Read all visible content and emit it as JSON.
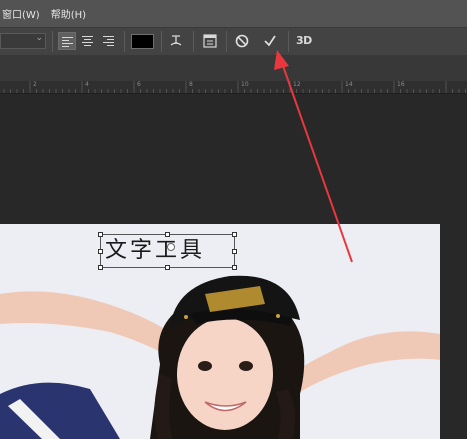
{
  "menu": {
    "items": [
      {
        "label": "窗口(W)"
      },
      {
        "label": "帮助(H)"
      }
    ]
  },
  "options_bar": {
    "font_size_value": "",
    "text_color": "#000000",
    "label_3d": "3D",
    "icons": [
      "align-left-icon",
      "align-center-icon",
      "align-right-icon",
      "warp-text-icon",
      "character-panel-icon",
      "cancel-icon",
      "commit-check-icon"
    ]
  },
  "ruler": {
    "labels": [
      "2",
      "4",
      "6",
      "8",
      "10",
      "12",
      "14",
      "16"
    ]
  },
  "canvas": {
    "text_layer": "文字工具"
  },
  "annotation": {
    "color": "#e8383d"
  }
}
